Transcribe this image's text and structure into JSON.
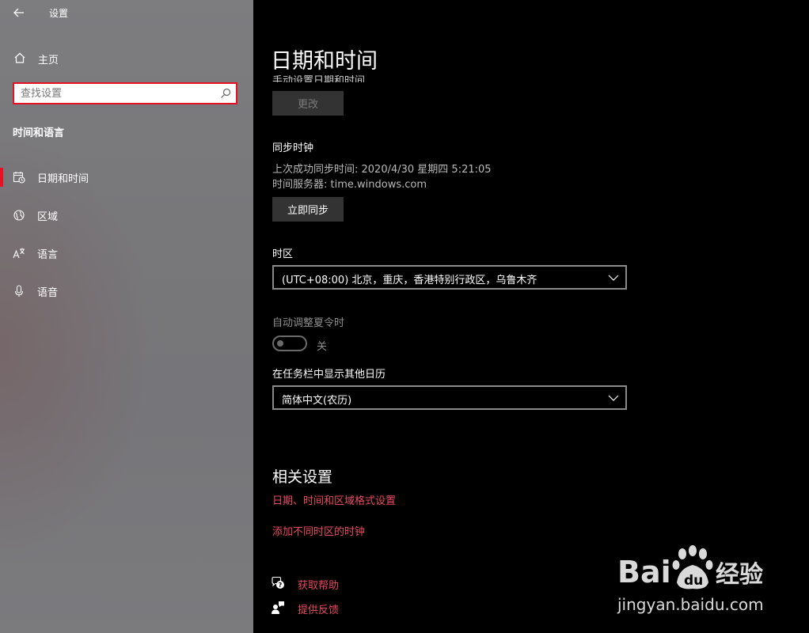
{
  "window": {
    "title": "设置"
  },
  "sidebar": {
    "home_label": "主页",
    "search_placeholder": "查找设置",
    "group_title": "时间和语言",
    "items": [
      {
        "label": "日期和时间",
        "icon": "calendar-clock-icon",
        "active": true
      },
      {
        "label": "区域",
        "icon": "globe-icon",
        "active": false
      },
      {
        "label": "语言",
        "icon": "language-icon",
        "active": false
      },
      {
        "label": "语音",
        "icon": "microphone-icon",
        "active": false
      }
    ]
  },
  "main": {
    "page_title": "日期和时间",
    "cutoff_label": "手动设置日期和时间",
    "change_button": "更改",
    "sync": {
      "heading": "同步时钟",
      "last_sync": "上次成功同步时间: 2020/4/30 星期四 5:21:05",
      "server": "时间服务器: time.windows.com",
      "button": "立即同步"
    },
    "timezone": {
      "label": "时区",
      "value": "(UTC+08:00) 北京，重庆，香港特别行政区，乌鲁木齐"
    },
    "dst": {
      "label": "自动调整夏令时",
      "state": "关"
    },
    "calendar": {
      "label": "在任务栏中显示其他日历",
      "value": "简体中文(农历)"
    },
    "related": {
      "heading": "相关设置",
      "links": [
        "日期、时间和区域格式设置",
        "添加不同时区的时钟"
      ]
    },
    "help": {
      "get_help": "获取帮助",
      "feedback": "提供反馈"
    }
  },
  "watermark": {
    "logo": "Bai du 经验",
    "url": "jingyan.baidu.com"
  },
  "colors": {
    "accent": "#e81123",
    "link": "#e84a5f",
    "main_bg": "#000000",
    "sidebar_bg": "#78787b"
  }
}
